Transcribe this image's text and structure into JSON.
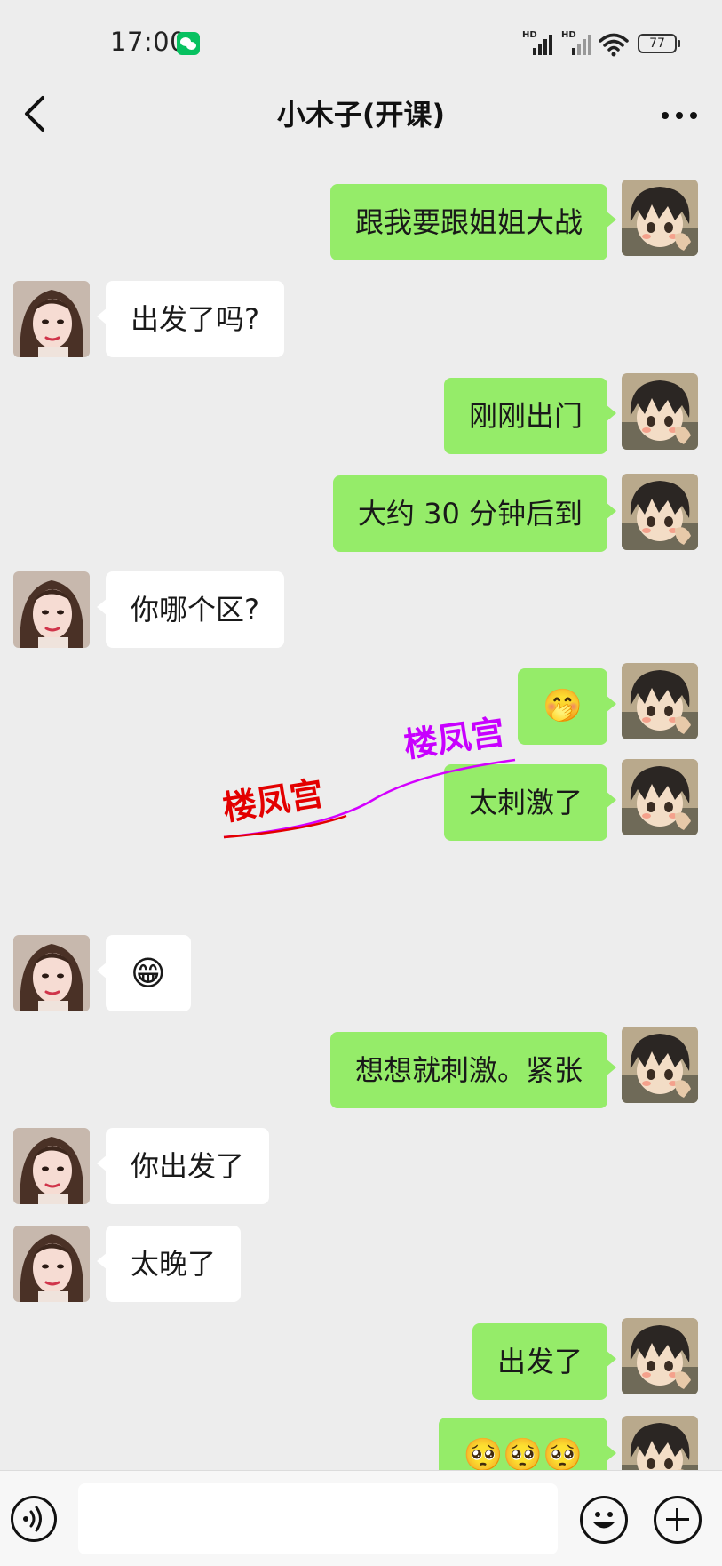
{
  "status_bar": {
    "time": "17:00",
    "app_icon": "wechat-icon",
    "signal_1_label": "HD",
    "signal_2_label": "HD",
    "battery": "77"
  },
  "header": {
    "title": "小木子(开课)",
    "back_icon": "chevron-left-icon",
    "more_icon": "more-dots-icon"
  },
  "messages": [
    {
      "from": "me",
      "text": "跟我要跟姐姐大战"
    },
    {
      "from": "her",
      "text": "出发了吗?"
    },
    {
      "from": "me",
      "text": "刚刚出门"
    },
    {
      "from": "me",
      "text": "大约 30 分钟后到"
    },
    {
      "from": "her",
      "text": "你哪个区?"
    },
    {
      "from": "me",
      "text": "🤭"
    },
    {
      "from": "me",
      "text": "太刺激了"
    },
    {
      "from": "her",
      "text": "😁"
    },
    {
      "from": "me",
      "text": "想想就刺激。紧张"
    },
    {
      "from": "her",
      "text": "你出发了"
    },
    {
      "from": "her",
      "text": "太晚了"
    },
    {
      "from": "me",
      "text": "出发了"
    },
    {
      "from": "me",
      "text": "🥺🥺🥺"
    }
  ],
  "watermark": {
    "text_red": "楼凤宫",
    "text_purple": "楼凤宫",
    "color_red": "#e30000",
    "color_purple": "#c800ff"
  },
  "input_bar": {
    "voice_icon": "voice-icon",
    "emoji_icon": "emoji-icon",
    "plus_icon": "plus-icon"
  },
  "colors": {
    "background": "#ededed",
    "my_bubble": "#95ec69",
    "her_bubble": "#ffffff",
    "wechat_green": "#07c160"
  }
}
